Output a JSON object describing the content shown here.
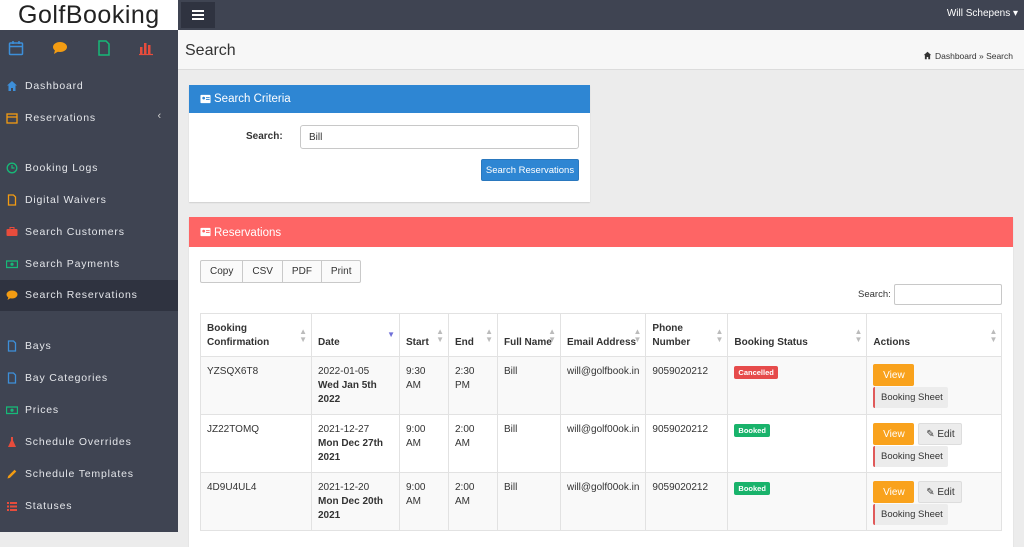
{
  "app": {
    "logo_text": "GolfBooking",
    "user_name": "Will Schepens"
  },
  "sidebar": {
    "quick_icons": [
      "calendar-icon",
      "chat-bubble-icon",
      "file-icon",
      "bar-chart-icon"
    ],
    "items": [
      {
        "label": "Dashboard",
        "icon": "home-icon",
        "color": "#3d8fd9"
      },
      {
        "label": "Reservations",
        "icon": "calendar-icon",
        "color": "#f39c12",
        "caret": "‹"
      },
      {
        "label": "Booking Logs",
        "icon": "clock-icon",
        "color": "#17b978"
      },
      {
        "label": "Digital Waivers",
        "icon": "file-icon",
        "color": "#f39c12"
      },
      {
        "label": "Search Customers",
        "icon": "users-icon",
        "color": "#e74c3c"
      },
      {
        "label": "Search Payments",
        "icon": "money-icon",
        "color": "#17b978"
      },
      {
        "label": "Search Reservations",
        "icon": "chat-bubble-icon",
        "color": "#f39c12"
      },
      {
        "label": "Bays",
        "icon": "file-outline-icon",
        "color": "#3d8fd9"
      },
      {
        "label": "Bay Categories",
        "icon": "file-outline-icon",
        "color": "#3d8fd9"
      },
      {
        "label": "Prices",
        "icon": "money-icon",
        "color": "#17b978"
      },
      {
        "label": "Schedule Overrides",
        "icon": "flask-icon",
        "color": "#e74c3c"
      },
      {
        "label": "Schedule Templates",
        "icon": "pencil-icon",
        "color": "#f39c12"
      },
      {
        "label": "Statuses",
        "icon": "list-icon",
        "color": "#e74c3c"
      }
    ]
  },
  "header": {
    "title": "Search",
    "breadcrumb": {
      "home": "Dashboard",
      "separator": "»",
      "current": "Search"
    }
  },
  "criteria": {
    "title": "Search Criteria",
    "search_label": "Search:",
    "search_value": "Bill",
    "button_label": "Search Reservations",
    "header_color": "#2e86d3"
  },
  "reservations": {
    "title": "Reservations",
    "header_color": "#fe6565",
    "export_buttons": [
      "Copy",
      "CSV",
      "PDF",
      "Print"
    ],
    "table_search_label": "Search:",
    "columns": [
      "Booking Confirmation",
      "Date",
      "Start",
      "End",
      "Full Name",
      "Email Address",
      "Phone Number",
      "Booking Status",
      "Actions"
    ],
    "rows": [
      {
        "confirmation": "YZSQX6T8",
        "date": "2022-01-05",
        "date_long": "Wed Jan 5th 2022",
        "start": "9:30 AM",
        "end": "2:30 PM",
        "name": "Bill",
        "email": "will@golfbook.in",
        "phone": "9059020212",
        "status": "Cancelled",
        "actions": [
          "View",
          "Booking Sheet"
        ]
      },
      {
        "confirmation": "JZ22TOMQ",
        "date": "2021-12-27",
        "date_long": "Mon Dec 27th 2021",
        "start": "9:00 AM",
        "end": "2:00 AM",
        "name": "Bill",
        "email": "will@golf00ok.in",
        "phone": "9059020212",
        "status": "Booked",
        "actions": [
          "View",
          "Edit",
          "Booking Sheet"
        ]
      },
      {
        "confirmation": "4D9U4UL4",
        "date": "2021-12-20",
        "date_long": "Mon Dec 20th 2021",
        "start": "9:00 AM",
        "end": "2:00 AM",
        "name": "Bill",
        "email": "will@golf00ok.in",
        "phone": "9059020212",
        "status": "Booked",
        "actions": [
          "View",
          "Edit",
          "Booking Sheet"
        ]
      }
    ]
  }
}
